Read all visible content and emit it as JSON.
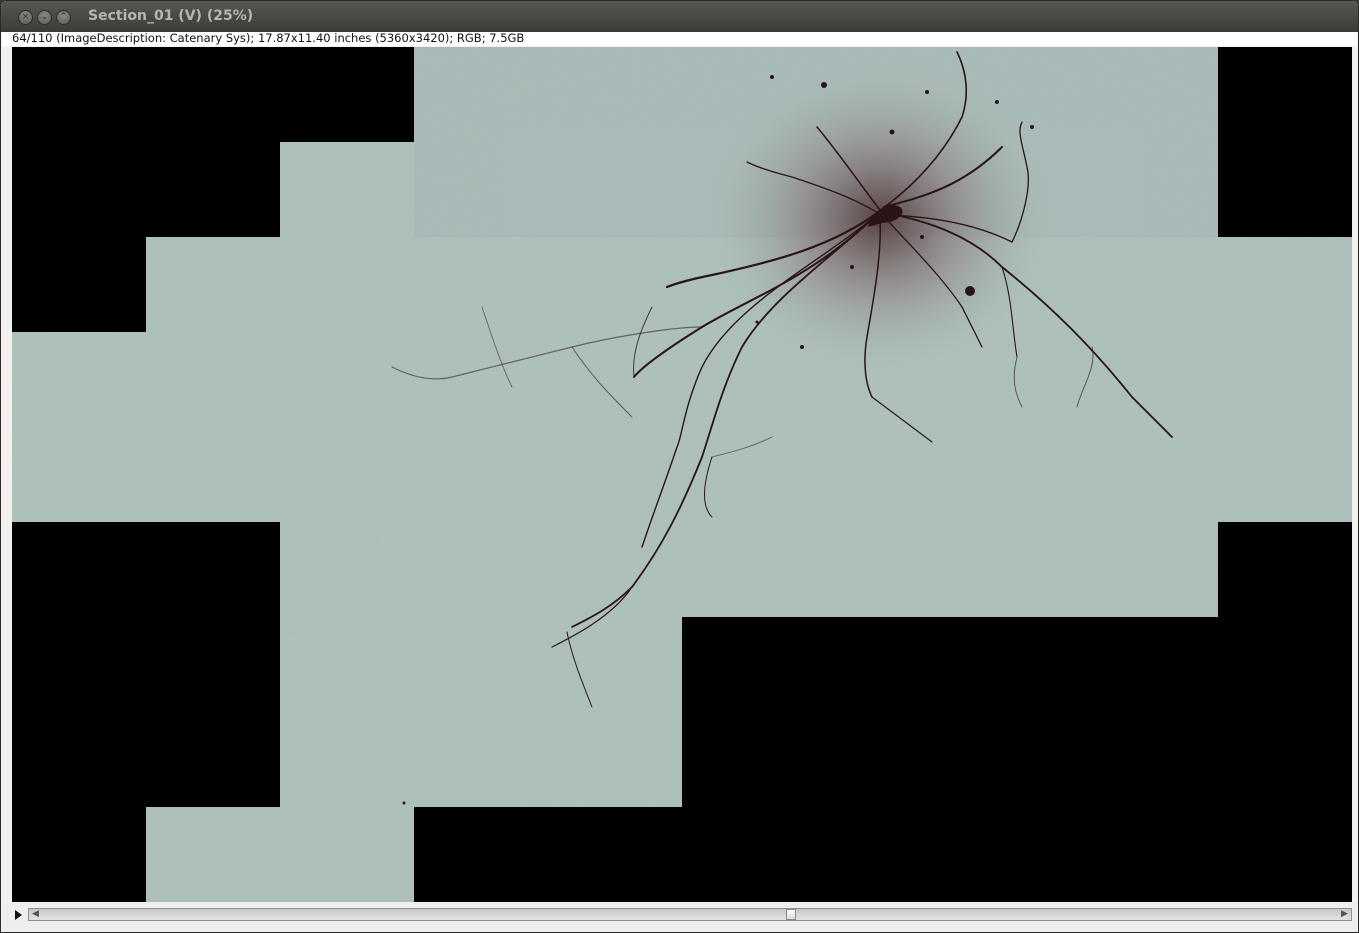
{
  "window": {
    "title": "Section_01 (V) (25%)",
    "buttons": {
      "close_icon": "×",
      "minimize_icon": "⌄",
      "maximize_icon": "⌃"
    }
  },
  "info_bar": {
    "text": "64/110 (ImageDescription: Catenary Sys); 17.87x11.40 inches (5360x3420); RGB; 7.5GB"
  },
  "image": {
    "tissue_color": "#a9bcb8",
    "background_color": "#000000",
    "neuron_color": "#2a1418"
  },
  "slice_control": {
    "play_icon": "play-icon",
    "left_arrow": "◀",
    "right_arrow": "▶",
    "current_slice": 64,
    "total_slices": 110
  }
}
